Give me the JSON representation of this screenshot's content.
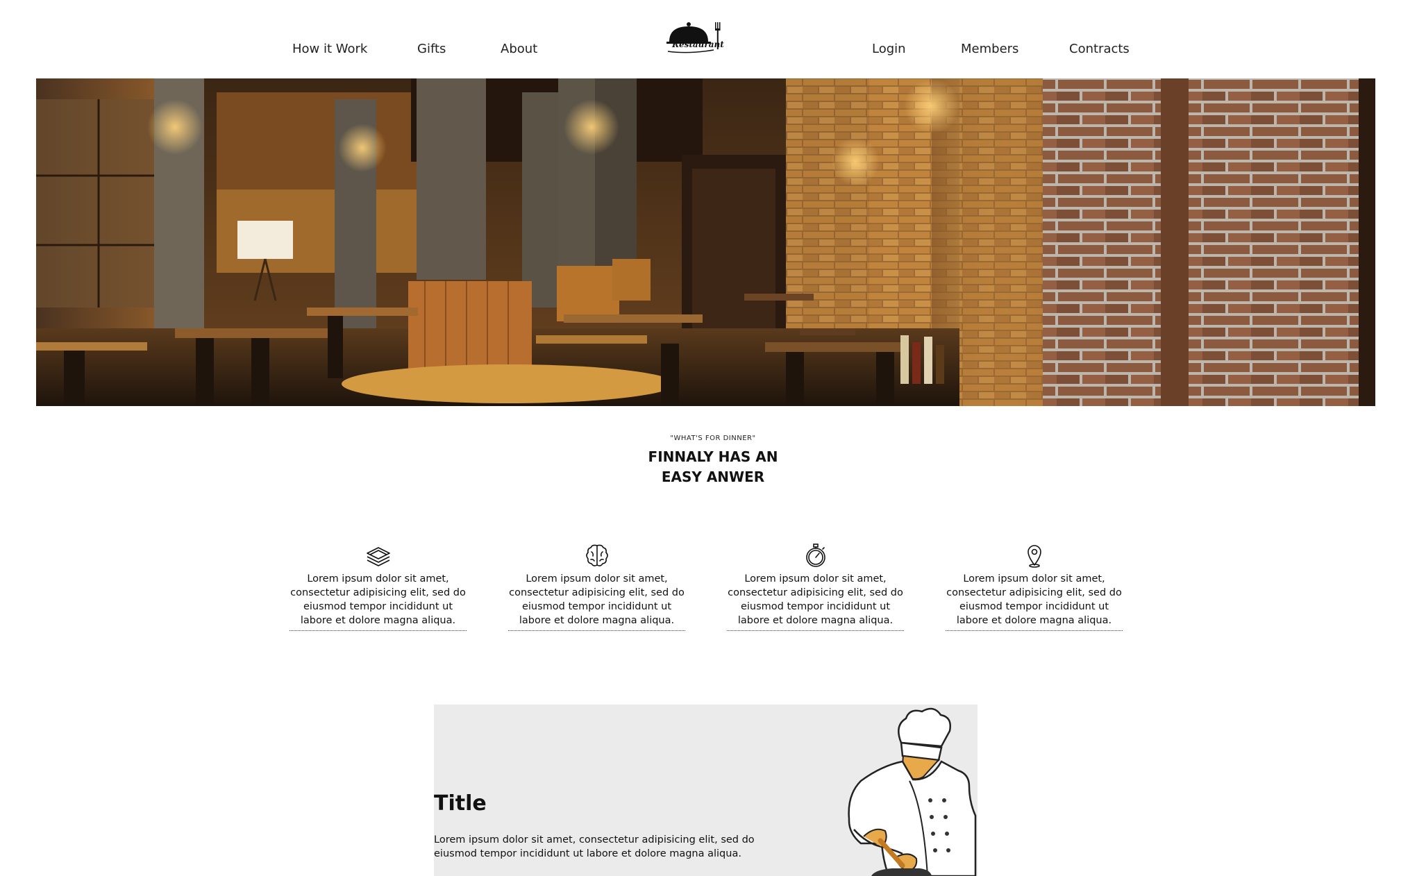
{
  "nav": {
    "left": [
      {
        "label": "How it Work"
      },
      {
        "label": "Gifts"
      },
      {
        "label": "About"
      }
    ],
    "right": [
      {
        "label": "Login"
      },
      {
        "label": "Members"
      },
      {
        "label": "Contracts"
      }
    ],
    "logo_text": "Restaurant",
    "logo_icon": "cloche-fork-knife-icon"
  },
  "tagline": {
    "kicker": "\"WHAT'S FOR DINNER\"",
    "line1": "FINNALY HAS AN",
    "line2": "EASY ANWER"
  },
  "features": [
    {
      "icon": "book-stack-icon",
      "text": "Lorem ipsum dolor sit amet, consectetur adipisicing elit, sed do eiusmod tempor incididunt ut labore et dolore magna aliqua."
    },
    {
      "icon": "brain-icon",
      "text": "Lorem ipsum dolor sit amet, consectetur adipisicing elit, sed do eiusmod tempor incididunt ut labore et dolore magna aliqua."
    },
    {
      "icon": "stopwatch-icon",
      "text": "Lorem ipsum dolor sit amet, consectetur adipisicing elit, sed do eiusmod tempor incididunt ut labore et dolore magna aliqua."
    },
    {
      "icon": "location-pin-icon",
      "text": "Lorem ipsum dolor sit amet, consectetur adipisicing elit, sed do eiusmod tempor incididunt ut labore et dolore magna aliqua."
    }
  ],
  "card": {
    "title": "Title",
    "text": "Lorem ipsum dolor sit amet, consectetur adipisicing elit, sed do eiusmod tempor incididunt ut labore et dolore magna aliqua."
  },
  "colors": {
    "background": "#ffffff",
    "card_background": "#ebebeb",
    "text": "#111111",
    "hero_wood": "#b8742a",
    "hero_brick": "#8a5a3c"
  }
}
